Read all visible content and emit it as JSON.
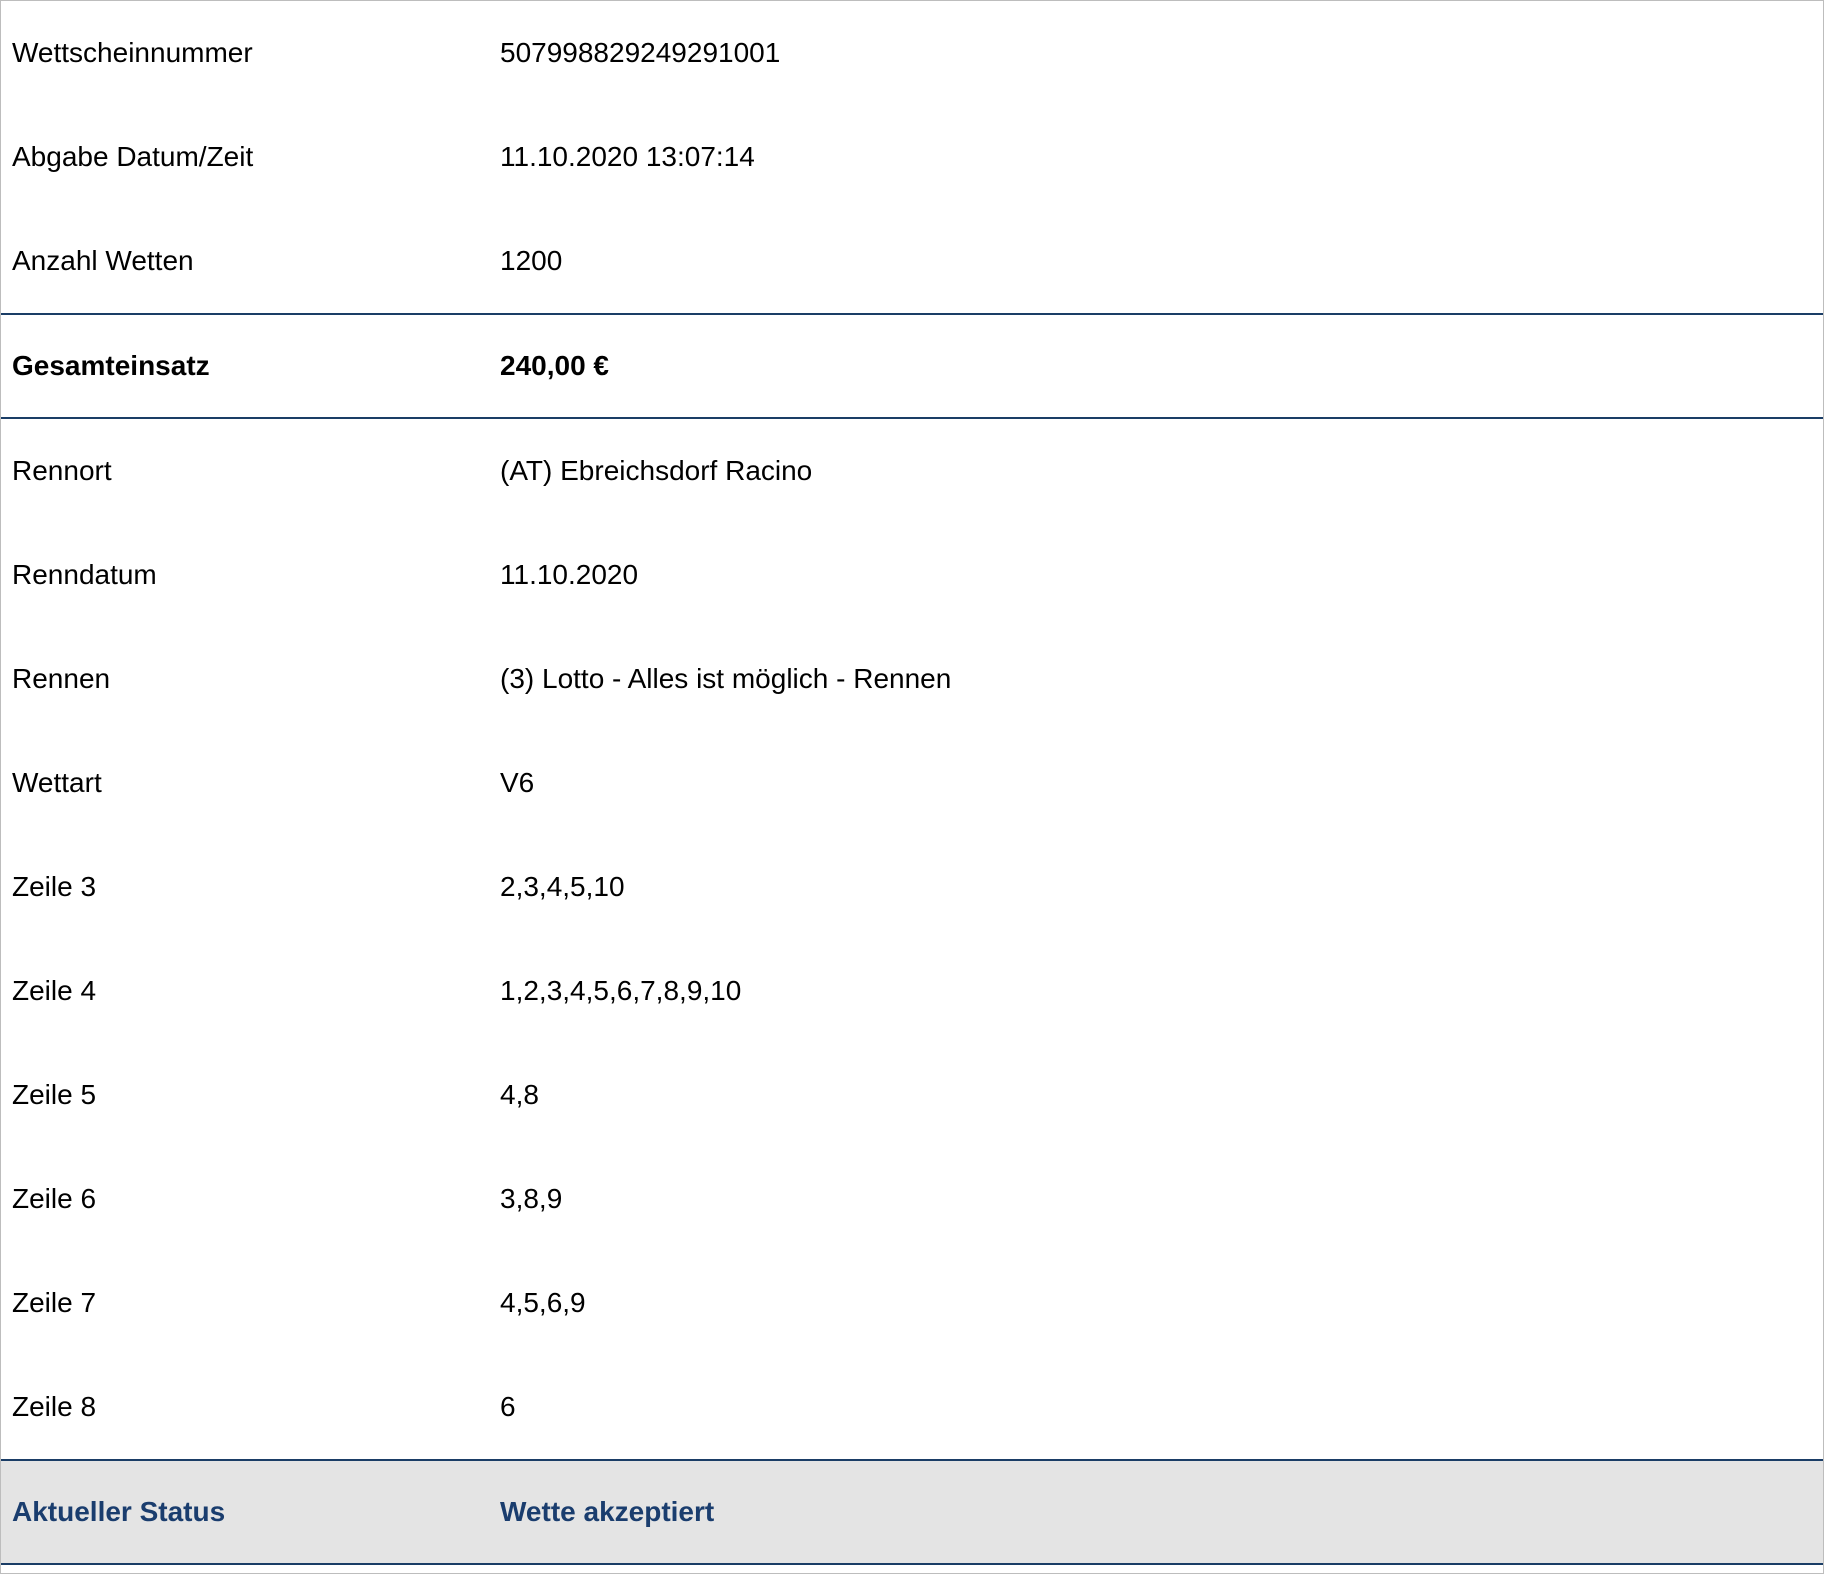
{
  "summary_rows": [
    {
      "label": "Wettscheinnummer",
      "value": "507998829249291001"
    },
    {
      "label": "Abgabe Datum/Zeit",
      "value": "11.10.2020 13:07:14"
    },
    {
      "label": "Anzahl Wetten",
      "value": "1200"
    }
  ],
  "total": {
    "label": "Gesamteinsatz",
    "value": "240,00 €"
  },
  "detail_rows": [
    {
      "label": "Rennort",
      "value": "(AT) Ebreichsdorf Racino"
    },
    {
      "label": "Renndatum",
      "value": "11.10.2020"
    },
    {
      "label": "Rennen",
      "value": "(3) Lotto - Alles ist möglich - Rennen"
    },
    {
      "label": "Wettart",
      "value": "V6"
    },
    {
      "label": "Zeile 3",
      "value": "2,3,4,5,10"
    },
    {
      "label": "Zeile 4",
      "value": "1,2,3,4,5,6,7,8,9,10"
    },
    {
      "label": "Zeile 5",
      "value": "4,8"
    },
    {
      "label": "Zeile 6",
      "value": "3,8,9"
    },
    {
      "label": "Zeile 7",
      "value": "4,5,6,9"
    },
    {
      "label": "Zeile 8",
      "value": "6"
    }
  ],
  "status": {
    "label": "Aktueller Status",
    "value": "Wette akzeptiert"
  },
  "colors": {
    "divider": "#1a3d66",
    "status_text": "#1a3d6e",
    "status_background": "#e4e4e4"
  }
}
